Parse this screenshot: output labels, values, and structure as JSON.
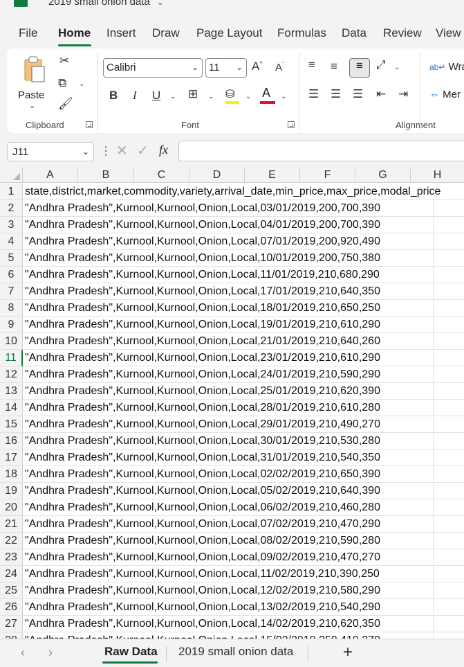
{
  "window": {
    "title": "2019 small onion data"
  },
  "ribbon_tabs": [
    "File",
    "Home",
    "Insert",
    "Draw",
    "Page Layout",
    "Formulas",
    "Data",
    "Review",
    "View"
  ],
  "ribbon": {
    "clipboard_label": "Clipboard",
    "paste_label": "Paste",
    "font_label": "Font",
    "alignment_label": "Alignment",
    "font_name": "Calibri",
    "font_size": "11",
    "bold": "B",
    "italic": "I",
    "underline": "U",
    "wrap_text": "Wra",
    "merge": "Mer"
  },
  "formula_bar": {
    "name_box": "J11",
    "fx": "fx",
    "content": ""
  },
  "columns": [
    "A",
    "B",
    "C",
    "D",
    "E",
    "F",
    "G",
    "H"
  ],
  "selected_row": 11,
  "rows": [
    "state,district,market,commodity,variety,arrival_date,min_price,max_price,modal_price",
    "\"Andhra Pradesh\",Kurnool,Kurnool,Onion,Local,03/01/2019,200,700,390",
    "\"Andhra Pradesh\",Kurnool,Kurnool,Onion,Local,04/01/2019,200,700,390",
    "\"Andhra Pradesh\",Kurnool,Kurnool,Onion,Local,07/01/2019,200,920,490",
    "\"Andhra Pradesh\",Kurnool,Kurnool,Onion,Local,10/01/2019,200,750,380",
    "\"Andhra Pradesh\",Kurnool,Kurnool,Onion,Local,11/01/2019,210,680,290",
    "\"Andhra Pradesh\",Kurnool,Kurnool,Onion,Local,17/01/2019,210,640,350",
    "\"Andhra Pradesh\",Kurnool,Kurnool,Onion,Local,18/01/2019,210,650,250",
    "\"Andhra Pradesh\",Kurnool,Kurnool,Onion,Local,19/01/2019,210,610,290",
    "\"Andhra Pradesh\",Kurnool,Kurnool,Onion,Local,21/01/2019,210,640,260",
    "\"Andhra Pradesh\",Kurnool,Kurnool,Onion,Local,23/01/2019,210,610,290",
    "\"Andhra Pradesh\",Kurnool,Kurnool,Onion,Local,24/01/2019,210,590,290",
    "\"Andhra Pradesh\",Kurnool,Kurnool,Onion,Local,25/01/2019,210,620,390",
    "\"Andhra Pradesh\",Kurnool,Kurnool,Onion,Local,28/01/2019,210,610,280",
    "\"Andhra Pradesh\",Kurnool,Kurnool,Onion,Local,29/01/2019,210,490,270",
    "\"Andhra Pradesh\",Kurnool,Kurnool,Onion,Local,30/01/2019,210,530,280",
    "\"Andhra Pradesh\",Kurnool,Kurnool,Onion,Local,31/01/2019,210,540,350",
    "\"Andhra Pradesh\",Kurnool,Kurnool,Onion,Local,02/02/2019,210,650,390",
    "\"Andhra Pradesh\",Kurnool,Kurnool,Onion,Local,05/02/2019,210,640,390",
    "\"Andhra Pradesh\",Kurnool,Kurnool,Onion,Local,06/02/2019,210,460,280",
    "\"Andhra Pradesh\",Kurnool,Kurnool,Onion,Local,07/02/2019,210,470,290",
    "\"Andhra Pradesh\",Kurnool,Kurnool,Onion,Local,08/02/2019,210,590,280",
    "\"Andhra Pradesh\",Kurnool,Kurnool,Onion,Local,09/02/2019,210,470,270",
    "\"Andhra Pradesh\",Kurnool,Kurnool,Onion,Local,11/02/2019,210,390,250",
    "\"Andhra Pradesh\",Kurnool,Kurnool,Onion,Local,12/02/2019,210,580,290",
    "\"Andhra Pradesh\",Kurnool,Kurnool,Onion,Local,13/02/2019,210,540,290",
    "\"Andhra Pradesh\",Kurnool,Kurnool,Onion,Local,14/02/2019,210,620,350",
    "\"Andhra Pradesh\",Kurnool,Kurnool,Onion,Local,15/02/2019,250,410,370"
  ],
  "sheets": [
    "Raw Data",
    "2019 small onion data"
  ],
  "active_sheet": "Raw Data",
  "colors": {
    "accent": "#107c41",
    "font_color_bar": "#e81123",
    "highlight_bar": "#ffef00"
  }
}
